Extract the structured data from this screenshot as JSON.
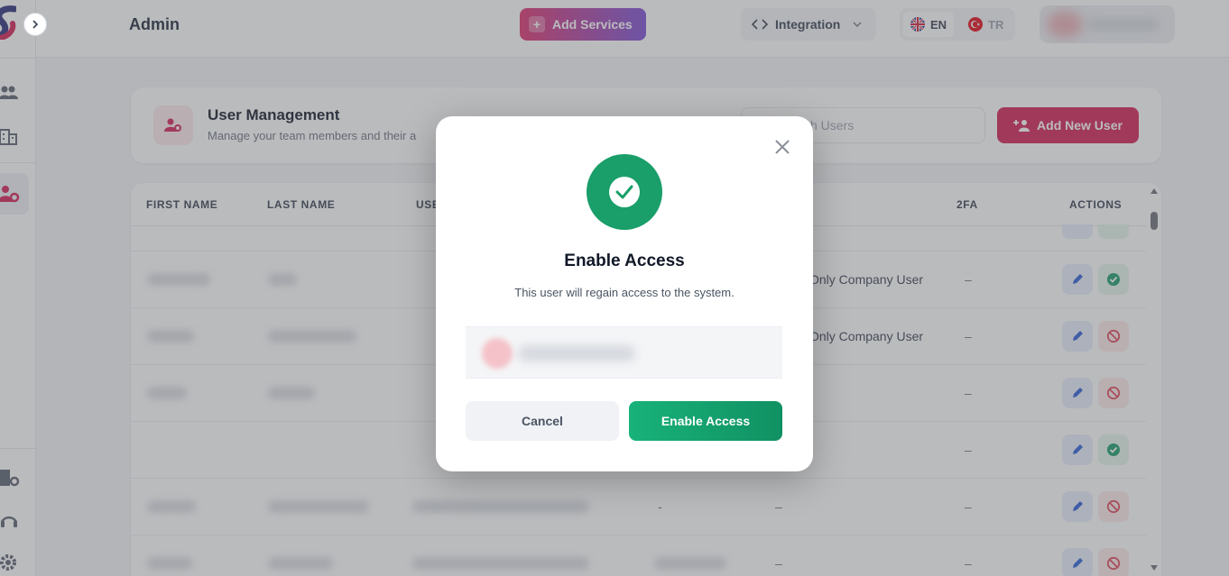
{
  "header": {
    "title": "Admin",
    "add_services_label": "Add Services",
    "integration_label": "Integration",
    "languages": {
      "en": "EN",
      "tr": "TR",
      "selected": "EN"
    }
  },
  "user_management": {
    "title": "User Management",
    "subtitle": "Manage your team members and their a",
    "search_placeholder": "h Users",
    "add_user_label": "Add New User"
  },
  "table": {
    "columns": {
      "first_name": "FIRST NAME",
      "last_name": "LAST NAME",
      "user": "USE",
      "twofa": "2FA",
      "actions": "ACTIONS"
    },
    "rows": [
      {
        "role": "Only Company User",
        "twofa": "–",
        "status": "enabled"
      },
      {
        "role": "Only Company User",
        "twofa": "–",
        "status": "disabled"
      },
      {
        "role": "",
        "twofa": "–",
        "status": "disabled"
      },
      {
        "role": "",
        "twofa": "–",
        "status": "enabled"
      },
      {
        "role": "",
        "col_a": "-",
        "col_b": "–",
        "twofa": "–",
        "status": "disabled"
      },
      {
        "role": "",
        "col_a": "",
        "col_b": "–",
        "twofa": "–",
        "status": "disabled"
      }
    ]
  },
  "modal": {
    "title": "Enable Access",
    "description": "This user will regain access to the system.",
    "cancel_label": "Cancel",
    "confirm_label": "Enable Access"
  },
  "colors": {
    "brand_pink": "#d41f55",
    "success_green": "#1a9e6a",
    "edit_blue": "#2d5fd8",
    "danger_red": "#e0485a"
  }
}
